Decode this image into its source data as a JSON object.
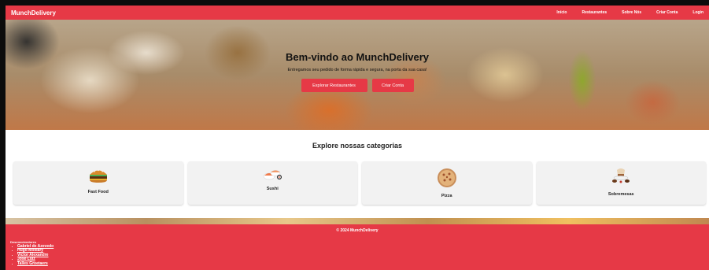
{
  "navbar": {
    "brand": "MunchDelivery",
    "links": [
      "Início",
      "Restaurantes",
      "Sobre Nós",
      "Criar Conta",
      "Login"
    ]
  },
  "hero": {
    "title": "Bem-vindo ao MunchDelivery",
    "subtitle": "Entregamos seu pedido de forma rápida e segura, na porta da sua casa!",
    "explore_button": "Explorar Restaurantes",
    "create_button": "Criar Conta"
  },
  "categories": {
    "title": "Explore nossas categorias",
    "items": [
      {
        "label": "Fast Food",
        "icon": "burger-icon"
      },
      {
        "label": "Sushi",
        "icon": "sushi-icon"
      },
      {
        "label": "Pizza",
        "icon": "pizza-icon"
      },
      {
        "label": "Sobremesas",
        "icon": "dessert-icon"
      }
    ]
  },
  "footer": {
    "copyright": "© 2024 MunchDelivery",
    "developers_title": "Desenvolvedores",
    "developers": [
      "Gabriel de Azevedo",
      "Hugo Molliary",
      "Victor Alexandre",
      "José Luiz",
      "Talles Groetaers"
    ]
  },
  "colors": {
    "accent": "#e63946"
  }
}
